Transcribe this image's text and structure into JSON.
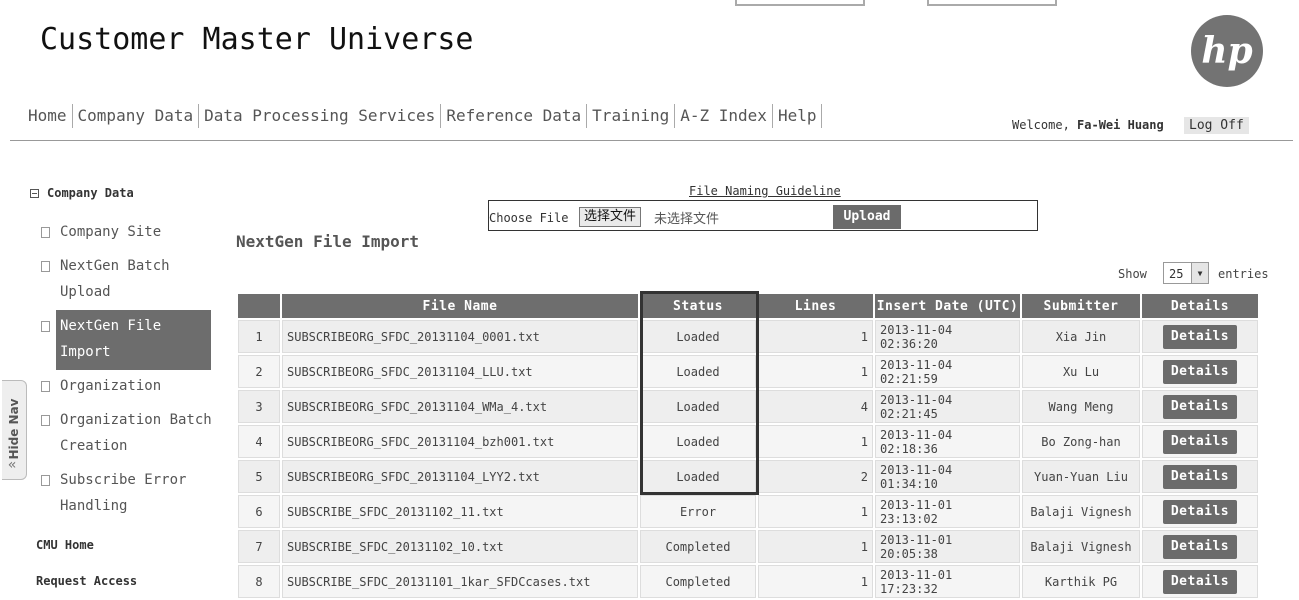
{
  "app": {
    "title": "Customer Master Universe",
    "logo_text": "hp"
  },
  "nav": {
    "items": [
      "Home",
      "Company Data",
      "Data Processing Services",
      "Reference Data",
      "Training",
      "A-Z Index",
      "Help"
    ]
  },
  "user": {
    "welcome_prefix": "Welcome,",
    "name": "Fa-Wei Huang",
    "logoff": "Log Off"
  },
  "sidebar": {
    "header": "Company Data",
    "items": [
      {
        "l1": "Company Site",
        "l2": ""
      },
      {
        "l1": "NextGen Batch",
        "l2": "Upload"
      },
      {
        "l1": "NextGen File",
        "l2": "Import"
      },
      {
        "l1": "Organization",
        "l2": ""
      },
      {
        "l1": "Organization Batch",
        "l2": "Creation"
      },
      {
        "l1": "Subscribe Error",
        "l2": "Handling"
      }
    ],
    "links": [
      "CMU Home",
      "Request Access"
    ],
    "hide_nav": "Hide Nav",
    "hide_nav_icon": "«"
  },
  "upload": {
    "guideline": "File Naming Guideline",
    "choose_label": "Choose File",
    "choose_button": "选择文件",
    "no_file": "未选择文件",
    "upload_button": "Upload"
  },
  "page": {
    "title": "NextGen File Import"
  },
  "pager": {
    "show": "Show",
    "value": "25",
    "entries": "entries"
  },
  "table": {
    "headers": [
      "",
      "File Name",
      "Status",
      "Lines",
      "Insert Date (UTC)",
      "Submitter",
      "Details"
    ],
    "rows": [
      {
        "n": "1",
        "file": "SUBSCRIBEORG_SFDC_20131104_0001.txt",
        "status": "Loaded",
        "lines": "1",
        "date": "2013-11-04 02:36:20",
        "submitter": "Xia Jin",
        "details": "Details"
      },
      {
        "n": "2",
        "file": "SUBSCRIBEORG_SFDC_20131104_LLU.txt",
        "status": "Loaded",
        "lines": "1",
        "date": "2013-11-04 02:21:59",
        "submitter": "Xu Lu",
        "details": "Details"
      },
      {
        "n": "3",
        "file": "SUBSCRIBEORG_SFDC_20131104_WMa_4.txt",
        "status": "Loaded",
        "lines": "4",
        "date": "2013-11-04 02:21:45",
        "submitter": "Wang Meng",
        "details": "Details"
      },
      {
        "n": "4",
        "file": "SUBSCRIBEORG_SFDC_20131104_bzh001.txt",
        "status": "Loaded",
        "lines": "1",
        "date": "2013-11-04 02:18:36",
        "submitter": "Bo Zong-han",
        "details": "Details"
      },
      {
        "n": "5",
        "file": "SUBSCRIBEORG_SFDC_20131104_LYY2.txt",
        "status": "Loaded",
        "lines": "2",
        "date": "2013-11-04 01:34:10",
        "submitter": "Yuan-Yuan Liu",
        "details": "Details"
      },
      {
        "n": "6",
        "file": "SUBSCRIBE_SFDC_20131102_11.txt",
        "status": "Error",
        "lines": "1",
        "date": "2013-11-01 23:13:02",
        "submitter": "Balaji Vignesh",
        "details": "Details"
      },
      {
        "n": "7",
        "file": "SUBSCRIBE_SFDC_20131102_10.txt",
        "status": "Completed",
        "lines": "1",
        "date": "2013-11-01 20:05:38",
        "submitter": "Balaji Vignesh",
        "details": "Details"
      },
      {
        "n": "8",
        "file": "SUBSCRIBE_SFDC_20131101_1kar_SFDCcases.txt",
        "status": "Completed",
        "lines": "1",
        "date": "2013-11-01 17:23:32",
        "submitter": "Karthik PG",
        "details": "Details"
      }
    ]
  }
}
